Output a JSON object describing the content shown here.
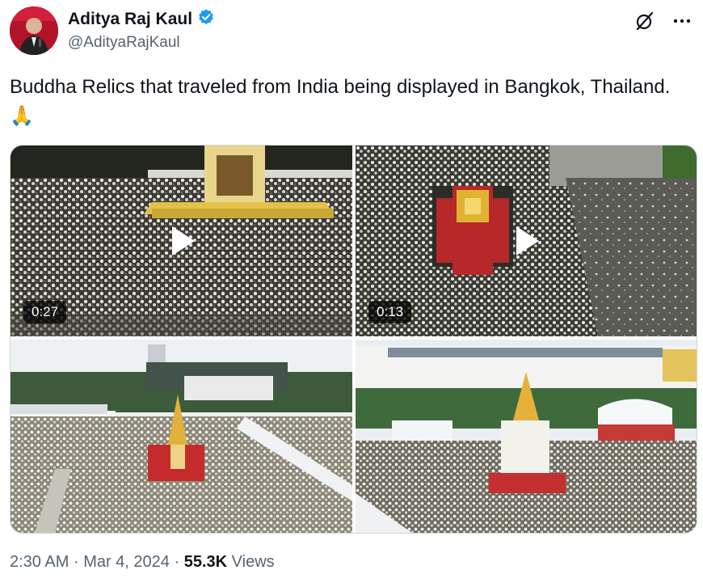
{
  "author": {
    "name": "Aditya Raj Kaul",
    "handle": "@AdityaRajKaul",
    "verified": true
  },
  "icons": {
    "verified": "verified-badge-icon",
    "grok": "grok-icon",
    "more": "more-dots-icon",
    "play": "play-icon"
  },
  "tweet": {
    "text": "Buddha Relics that traveled from India being displayed in Bangkok, Thailand. 🙏"
  },
  "media": [
    {
      "type": "video",
      "duration": "0:27"
    },
    {
      "type": "video",
      "duration": "0:13"
    },
    {
      "type": "image"
    },
    {
      "type": "image"
    }
  ],
  "meta": {
    "time": "2:30 AM",
    "separator": "·",
    "date": "Mar 4, 2024",
    "views_count": "55.3K",
    "views_label": "Views"
  },
  "colors": {
    "accent": "#1d9bf0",
    "text": "#0f1419",
    "secondary": "#536471"
  }
}
